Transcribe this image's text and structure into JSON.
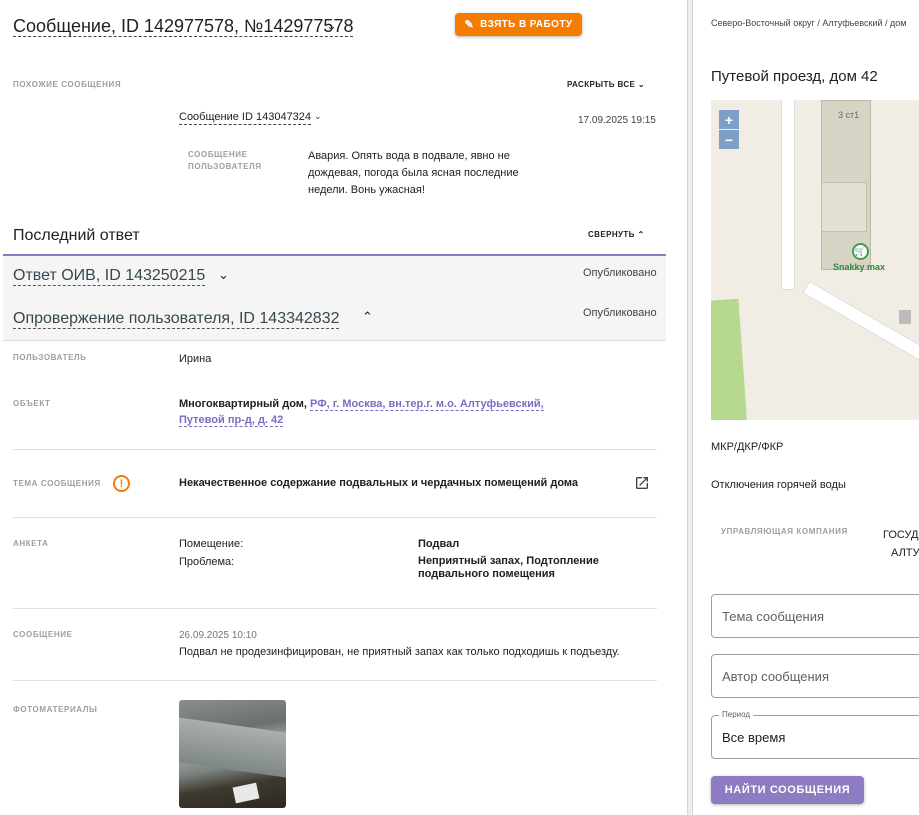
{
  "header": {
    "title": "Сообщение, ID 142977578, №142977578",
    "take_button": "Взять в работу"
  },
  "similar": {
    "label": "Похожие сообщения",
    "expand_all": "Раскрыть все",
    "message_link": "Сообщение ID 143047324",
    "date": "17.09.2025 19:15",
    "user_msg_label": "Сообщение пользователя",
    "user_msg_text": "Авария. Опять вода в подвале, явно не дождевая, погода была ясная последние недели. Вонь ужасная!"
  },
  "last_answer": {
    "title": "Последний ответ",
    "collapse": "Свернуть",
    "responses": [
      {
        "title": "Ответ ОИВ, ID 143250215",
        "status": "Опубликовано"
      },
      {
        "title": "Опровержение пользователя, ID 143342832",
        "status": "Опубликовано"
      }
    ]
  },
  "details": {
    "user_label": "Пользователь",
    "user_value": "Ирина",
    "object_label": "Объект",
    "object_type": "Многоквартирный дом,",
    "object_address": "РФ, г. Москва, вн.тер.г. м.о. Алтуфьевский, Путевой пр-д, д. 42",
    "topic_label": "Тема сообщения",
    "topic_value": "Некачественное содержание подвальных и чердачных помещений дома",
    "survey_label": "Анкета",
    "survey": [
      {
        "q": "Помещение:",
        "a": "Подвал"
      },
      {
        "q": "Проблема:",
        "a": "Неприятный запах, Подтопление подвального помещения"
      }
    ],
    "message_label": "Сообщение",
    "message_date": "26.09.2025 10:10",
    "message_text": "Подвал не продезинфицирован, не приятный запах как только подходишь к подъезду.",
    "photos_label": "Фотоматериалы"
  },
  "right": {
    "breadcrumb": "Северо-Восточный округ / Алтуфьевский / дом",
    "address": "Путевой проезд, дом 42",
    "map": {
      "building_label": "3 ст1",
      "poi_label": "Snakky max",
      "zoom_in": "+",
      "zoom_out": "−"
    },
    "mkr": "МКР/ДКР/ФКР",
    "hot_water": "Отключения горячей воды",
    "uk_label": "Управляющая компания",
    "uk_value_1": "ГОСУД",
    "uk_value_2": "АЛТУФ",
    "topic_placeholder": "Тема сообщения",
    "author_placeholder": "Автор сообщения",
    "period_legend": "Период",
    "period_value": "Все время",
    "find_button": "Найти сообщения"
  },
  "colors": {
    "accent_orange": "#f57c00",
    "accent_purple": "#8e7cc3",
    "link_purple": "#7e6bc4"
  },
  "icons": [
    "chevron-down-icon",
    "pencil-icon",
    "chevron-up-icon",
    "warning-icon",
    "external-link-icon",
    "shopping-basket-icon"
  ]
}
